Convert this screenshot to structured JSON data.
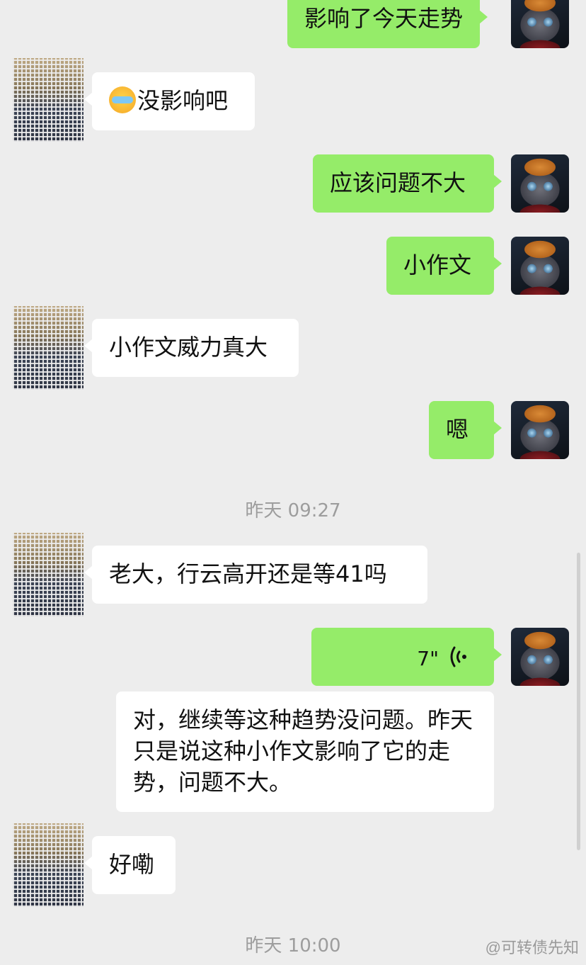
{
  "messages": [
    {
      "id": "m0",
      "side": "self",
      "text": "影响了今天走势",
      "partial": true
    },
    {
      "id": "m1",
      "side": "other",
      "emoji": "face-palm-emoji",
      "text": "没影响吧"
    },
    {
      "id": "m2",
      "side": "self",
      "text": "应该问题不大"
    },
    {
      "id": "m3",
      "side": "self",
      "text": "小作文"
    },
    {
      "id": "m4",
      "side": "other",
      "text": "小作文威力真大"
    },
    {
      "id": "m5",
      "side": "self",
      "text": "嗯"
    },
    {
      "id": "m6",
      "side": "other",
      "text": "老大，行云高开还是等41吗"
    },
    {
      "id": "m7",
      "side": "self",
      "type": "voice",
      "duration": "7\""
    },
    {
      "id": "m8",
      "side": "other",
      "text": "对，继续等这种趋势没问题。昨天只是说这种小作文影响了它的走势，问题不大。"
    },
    {
      "id": "m9",
      "side": "other",
      "text": "好嘞"
    }
  ],
  "timestamps": [
    "昨天 09:27",
    "昨天 10:00"
  ],
  "watermark": "@可转债先知",
  "colors": {
    "self_bubble": "#95ec69",
    "other_bubble": "#ffffff",
    "background": "#ededed",
    "timestamp": "#9d9d9d"
  },
  "icons": {
    "voice": "voice-wave-icon",
    "emoji": "face-palm-emoji"
  }
}
